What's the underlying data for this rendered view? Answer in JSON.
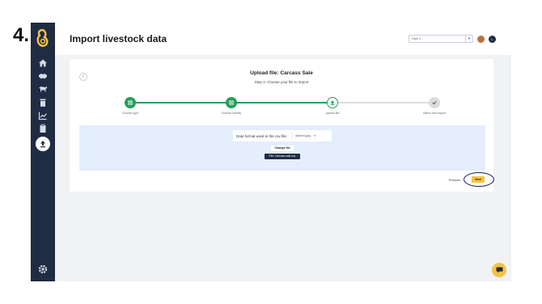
{
  "step_number": "4.",
  "sidebar": {
    "items": [
      {
        "icon": "home-icon"
      },
      {
        "icon": "handshake-icon"
      },
      {
        "icon": "cattle-icon"
      },
      {
        "icon": "trash-icon"
      },
      {
        "icon": "chart-icon"
      },
      {
        "icon": "clipboard-icon"
      },
      {
        "icon": "upload-icon",
        "active": true
      }
    ],
    "settings_icon": "gear-icon"
  },
  "header": {
    "title": "Import livestock data",
    "farm_select": "Farm 1",
    "user_initial": "L"
  },
  "card": {
    "title": "Upload file: Carcass Sale",
    "subtitle": "Step 3: Choose your file to import",
    "steps": [
      {
        "label": "Choose type",
        "state": "done"
      },
      {
        "label": "Choose activity",
        "state": "done"
      },
      {
        "label": "Upload file",
        "state": "current"
      },
      {
        "label": "Match and import",
        "state": "pending"
      }
    ],
    "date_format_label": "Date format used in the csv file:",
    "date_format_value": "dd/mm/yyyy",
    "change_file_label": "Change file",
    "file_chip": "File: Carcass sale.csv",
    "previous_label": "Previous",
    "next_label": "Next"
  },
  "colors": {
    "sidebar": "#1f2c44",
    "accent_green": "#22a05a",
    "accent_yellow": "#f5c542",
    "upload_bg": "#e4eefc"
  }
}
